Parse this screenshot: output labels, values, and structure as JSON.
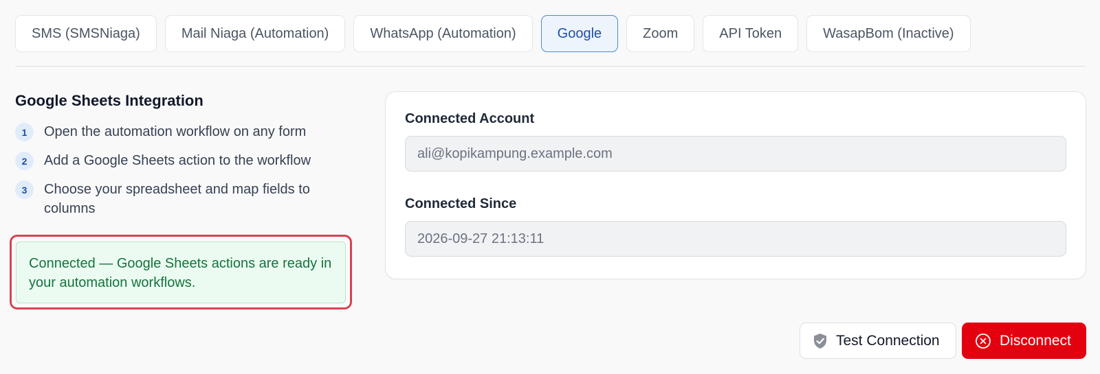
{
  "tabs": [
    {
      "label": "SMS (SMSNiaga)"
    },
    {
      "label": "Mail Niaga (Automation)"
    },
    {
      "label": "WhatsApp (Automation)"
    },
    {
      "label": "Google",
      "active": true
    },
    {
      "label": "Zoom"
    },
    {
      "label": "API Token"
    },
    {
      "label": "WasapBom (Inactive)"
    }
  ],
  "integration": {
    "title": "Google Sheets Integration",
    "steps": [
      {
        "number": "1",
        "text": "Open the automation workflow on any form"
      },
      {
        "number": "2",
        "text": "Add a Google Sheets action to the workflow"
      },
      {
        "number": "3",
        "text": "Choose your spreadsheet and map fields to columns"
      }
    ],
    "status_message": "Connected — Google Sheets actions are ready in your automation workflows."
  },
  "account": {
    "connected_account_label": "Connected Account",
    "connected_account_value": "ali@kopikampung.example.com",
    "connected_since_label": "Connected Since",
    "connected_since_value": "2026-09-27 21:13:11"
  },
  "actions": {
    "test_label": "Test Connection",
    "test_icon": "shield-check-icon",
    "disconnect_label": "Disconnect",
    "disconnect_icon": "close-circle-icon"
  },
  "colors": {
    "accent": "#1d4fa8",
    "success_bg": "#ecfbf1",
    "success_text": "#13733d",
    "highlight_border": "#d9434f",
    "danger": "#e3000f"
  }
}
